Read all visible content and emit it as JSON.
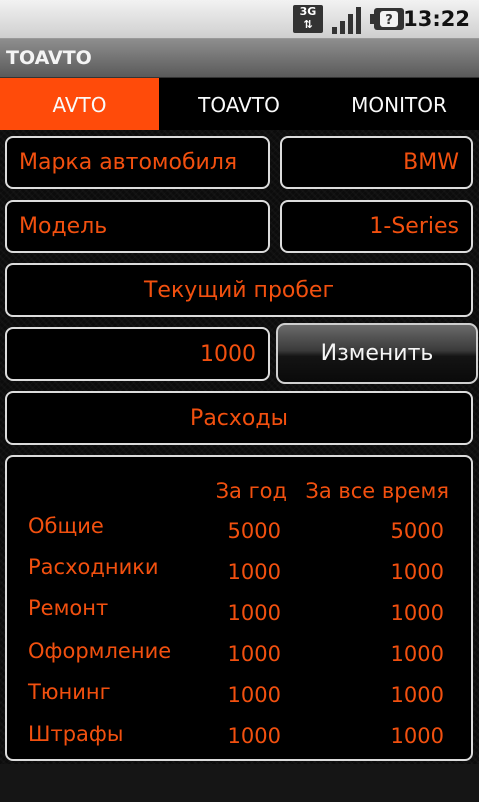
{
  "status_bar": {
    "network_type": "3G",
    "network_arrows": "⇅",
    "time": "13:22"
  },
  "app": {
    "title": "TOAVTO"
  },
  "tabs": [
    {
      "label": "AVTO",
      "selected": true
    },
    {
      "label": "TOAVTO",
      "selected": false
    },
    {
      "label": "MONITOR",
      "selected": false
    }
  ],
  "car": {
    "brand_label": "Марка автомобиля",
    "brand_value": "BMW",
    "model_label": "Модель",
    "model_value": "1-Series"
  },
  "mileage": {
    "title": "Текущий пробег",
    "value": "1000",
    "change_label": "Изменить"
  },
  "expenses": {
    "title": "Расходы",
    "header_year": "За год",
    "header_all": "За все время",
    "rows": [
      {
        "label": "Общие",
        "year": "5000",
        "all": "5000"
      },
      {
        "label": "Расходники",
        "year": "1000",
        "all": "1000"
      },
      {
        "label": "Ремонт",
        "year": "1000",
        "all": "1000"
      },
      {
        "label": "Оформление",
        "year": "1000",
        "all": "1000"
      },
      {
        "label": "Тюнинг",
        "year": "1000",
        "all": "1000"
      },
      {
        "label": "Штрафы",
        "year": "1000",
        "all": "1000"
      }
    ]
  },
  "colors": {
    "accent": "#ff4b0a",
    "text_orange": "#f2500f",
    "box_border": "#dcdcdc"
  },
  "icons": [
    "network-3g-icon",
    "signal-strength-icon",
    "battery-unknown-icon"
  ]
}
